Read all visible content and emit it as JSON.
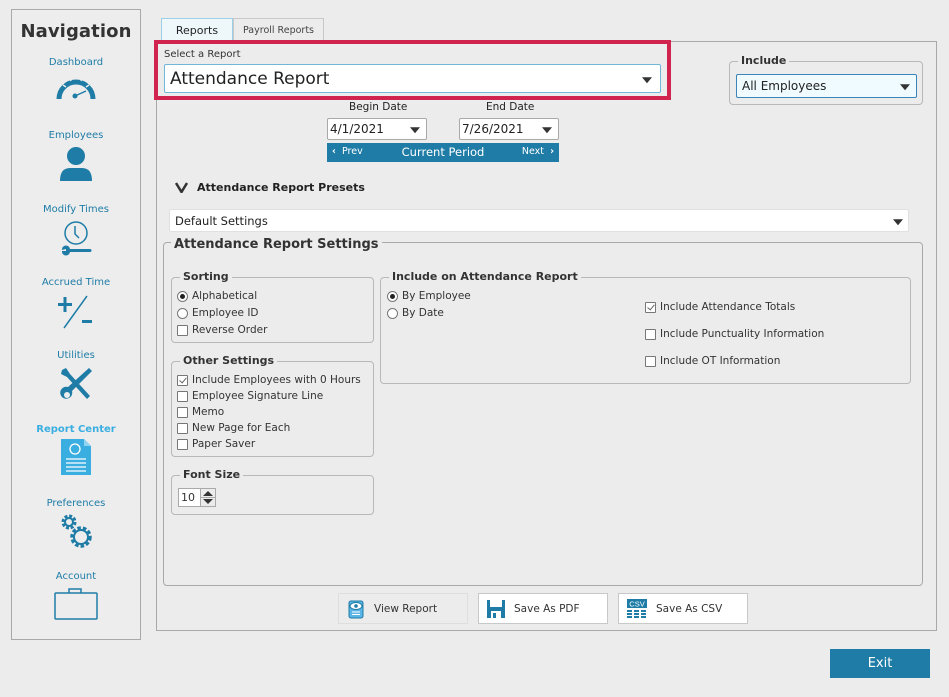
{
  "sidebar": {
    "title": "Navigation",
    "items": [
      {
        "label": "Dashboard",
        "icon": "dashboard-gauge-icon"
      },
      {
        "label": "Employees",
        "icon": "person-icon"
      },
      {
        "label": "Modify Times",
        "icon": "clock-wrench-icon"
      },
      {
        "label": "Accrued Time",
        "icon": "plus-minus-icon"
      },
      {
        "label": "Utilities",
        "icon": "tools-icon"
      },
      {
        "label": "Report Center",
        "icon": "report-document-icon",
        "active": true
      },
      {
        "label": "Preferences",
        "icon": "gears-icon"
      },
      {
        "label": "Account",
        "icon": "briefcase-icon"
      }
    ]
  },
  "tabs": [
    {
      "label": "Reports",
      "active": true
    },
    {
      "label": "Payroll Reports",
      "active": false
    }
  ],
  "report_select": {
    "caption": "Select a Report",
    "value": "Attendance Report"
  },
  "include": {
    "legend": "Include",
    "value": "All Employees"
  },
  "dates": {
    "begin_label": "Begin Date",
    "begin_value": "4/1/2021",
    "end_label": "End Date",
    "end_value": "7/26/2021",
    "prev_label": "Prev",
    "period_label": "Current Period",
    "next_label": "Next"
  },
  "presets": {
    "title": "Attendance Report Presets",
    "value": "Default Settings"
  },
  "settings": {
    "title": "Attendance Report Settings",
    "sorting": {
      "legend": "Sorting",
      "options": [
        {
          "label": "Alphabetical",
          "type": "radio",
          "checked": true
        },
        {
          "label": "Employee ID",
          "type": "radio",
          "checked": false
        },
        {
          "label": "Reverse Order",
          "type": "checkbox",
          "checked": false
        }
      ]
    },
    "other": {
      "legend": "Other Settings",
      "options": [
        {
          "label": "Include Employees with 0 Hours",
          "checked": true
        },
        {
          "label": "Employee Signature Line",
          "checked": false
        },
        {
          "label": "Memo",
          "checked": false
        },
        {
          "label": "New Page for Each",
          "checked": false
        },
        {
          "label": "Paper Saver",
          "checked": false
        }
      ]
    },
    "font_size": {
      "legend": "Font Size",
      "value": "10"
    },
    "include_on_report": {
      "legend": "Include on Attendance Report",
      "grouping": [
        {
          "label": "By Employee",
          "checked": true
        },
        {
          "label": "By Date",
          "checked": false
        }
      ],
      "options": [
        {
          "label": "Include Attendance Totals",
          "checked": true
        },
        {
          "label": "Include Punctuality Information",
          "checked": false
        },
        {
          "label": "Include OT Information",
          "checked": false
        }
      ]
    }
  },
  "actions": {
    "view_report": "View Report",
    "save_pdf": "Save As PDF",
    "save_csv": "Save As CSV",
    "csv_icon_text": "CSV",
    "exit": "Exit"
  },
  "colors": {
    "accent": "#1e7ca6",
    "active_nav": "#3aaee0",
    "highlight_border": "#d0234d"
  }
}
